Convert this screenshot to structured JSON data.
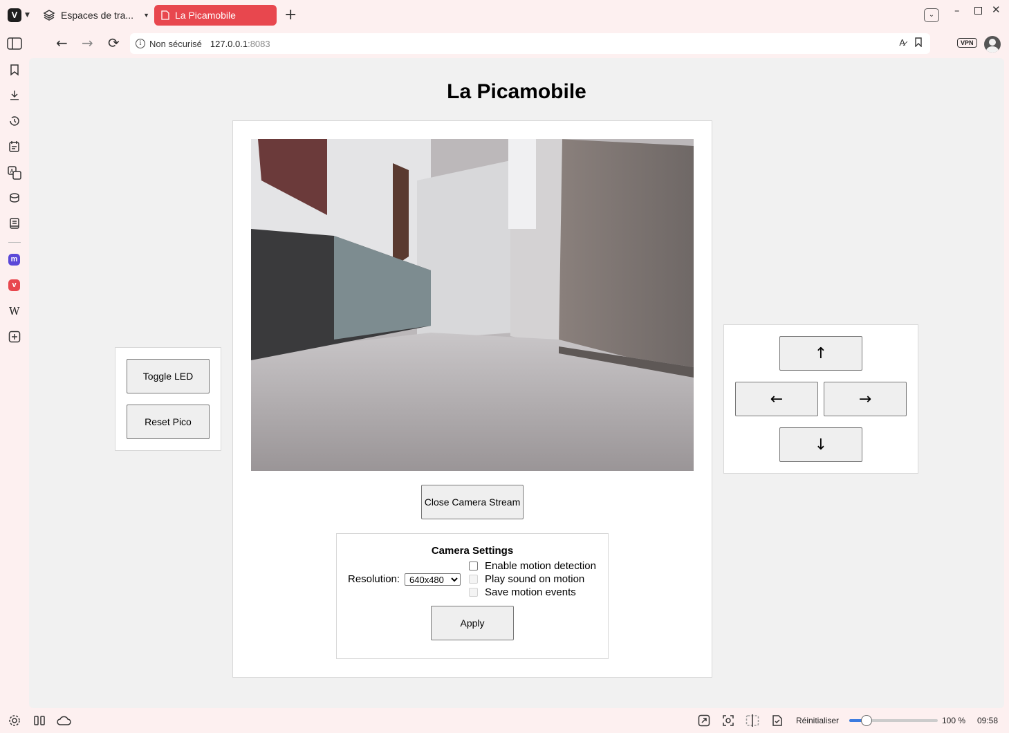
{
  "browser": {
    "logo": "V",
    "workspace_tab_label": "Espaces de tra...",
    "active_tab_label": "La Picamobile",
    "new_tab": "+",
    "url_security": "Non sécurisé",
    "url_host": "127.0.0.1",
    "url_port": ":8083",
    "vpn_label": "VPN",
    "icons": {
      "back": "back-arrow-icon",
      "forward": "forward-arrow-icon",
      "reload": "reload-icon",
      "translate": "translate-icon",
      "bookmark": "bookmark-icon"
    }
  },
  "sidebar": {
    "items": [
      "panel-toggle-icon",
      "bookmarks-icon",
      "downloads-icon",
      "history-icon",
      "notes-icon",
      "translate-icon",
      "reading-list-icon",
      "reader-icon",
      "mastodon-icon",
      "vivaldi-icon",
      "wikipedia-icon",
      "add-panel-icon"
    ],
    "wikipedia_glyph": "W"
  },
  "page": {
    "title": "La Picamobile",
    "left_panel": {
      "toggle_led": "Toggle LED",
      "reset_pico": "Reset Pico"
    },
    "controls": {
      "up": "↑",
      "left": "←",
      "right": "→",
      "down": "↓"
    },
    "close_stream": "Close Camera Stream",
    "settings": {
      "title": "Camera Settings",
      "resolution_label": "Resolution:",
      "resolution_value": "640x480",
      "motion_detection": "Enable motion detection",
      "play_sound": "Play sound on motion",
      "save_events": "Save motion events",
      "apply": "Apply"
    }
  },
  "statusbar": {
    "reset_label": "Réinitialiser",
    "zoom": "100 %",
    "zoom_fraction": 0.2,
    "clock": "09:58"
  },
  "colors": {
    "active_tab": "#e8474e",
    "chrome_bg": "#fdf0f0",
    "page_bg": "#f1f1f1",
    "zoom_accent": "#3a7be0"
  }
}
